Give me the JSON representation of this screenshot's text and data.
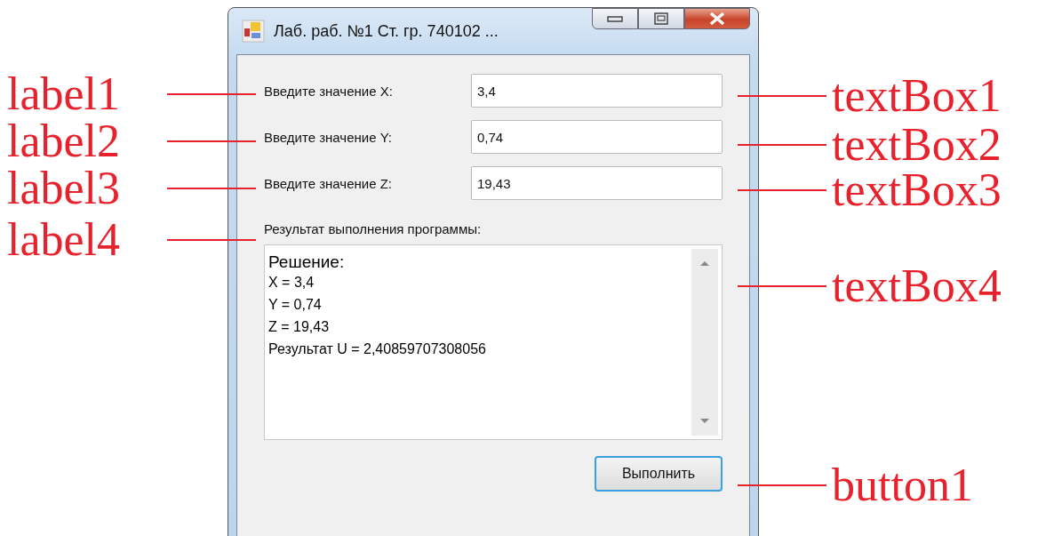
{
  "window": {
    "title": "Лаб. раб. №1 Ст. гр. 740102 ..."
  },
  "fields": [
    {
      "label": "Введите значение X:",
      "value": "3,4"
    },
    {
      "label": "Введите значение Y:",
      "value": "0,74"
    },
    {
      "label": "Введите значение Z:",
      "value": "19,43"
    }
  ],
  "result": {
    "label": "Результат выполнения программы:",
    "heading": "Решение:",
    "lines": [
      "X = 3,4",
      "Y = 0,74",
      "Z = 19,43",
      "Результат U = 2,40859707308056"
    ]
  },
  "button": "Выполнить",
  "left_callouts": [
    "label1",
    "label2",
    "label3",
    "label4"
  ],
  "right_callouts": [
    "textBox1",
    "textBox2",
    "textBox3",
    "textBox4",
    "button1"
  ]
}
